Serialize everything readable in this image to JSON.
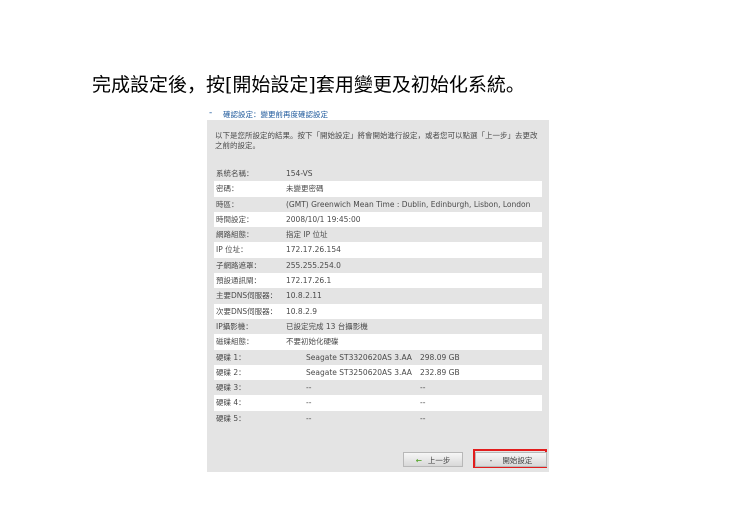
{
  "instruction": "完成設定後，按[開始設定]套用變更及初始化系統。",
  "panel": {
    "header_dash": "-",
    "title": "確認設定：變更前再度確認設定",
    "description": "以下是您所設定的結果。按下「開始設定」將會開始進行設定，或者您可以點選「上一步」去更改之前的設定。",
    "rows": [
      {
        "label": "系統名稱：",
        "value": "154-VS"
      },
      {
        "label": "密碼：",
        "value": "未變更密碼"
      },
      {
        "label": "時區：",
        "value": "(GMT) Greenwich Mean Time : Dublin, Edinburgh, Lisbon, London"
      },
      {
        "label": "時間設定：",
        "value": "2008/10/1 19:45:00"
      },
      {
        "label": "網路組態：",
        "value": "指定 IP 位址"
      },
      {
        "label": "IP 位址：",
        "value": "172.17.26.154"
      },
      {
        "label": "子網路遮罩：",
        "value": "255.255.254.0"
      },
      {
        "label": "預設通訊閘：",
        "value": "172.17.26.1"
      },
      {
        "label": "主要DNS伺服器：",
        "value": "10.8.2.11"
      },
      {
        "label": "次要DNS伺服器：",
        "value": "10.8.2.9"
      },
      {
        "label": "IP攝影機：",
        "value": "已設定完成 13 台攝影機"
      },
      {
        "label": "磁碟組態：",
        "value": "不要初始化硬碟"
      }
    ],
    "disks": [
      {
        "label": "硬碟 1：",
        "model": "Seagate ST3320620AS 3.AA",
        "size": "298.09 GB"
      },
      {
        "label": "硬碟 2：",
        "model": "Seagate ST3250620AS 3.AA",
        "size": "232.89 GB"
      },
      {
        "label": "硬碟 3：",
        "model": "--",
        "size": "--"
      },
      {
        "label": "硬碟 4：",
        "model": "--",
        "size": "--"
      },
      {
        "label": "硬碟 5：",
        "model": "--",
        "size": "--"
      }
    ],
    "back_label": "上一步",
    "back_arrow": "←",
    "start_label": "開始設定",
    "start_dash": "-",
    "highlight_color": "#e21d1d"
  }
}
